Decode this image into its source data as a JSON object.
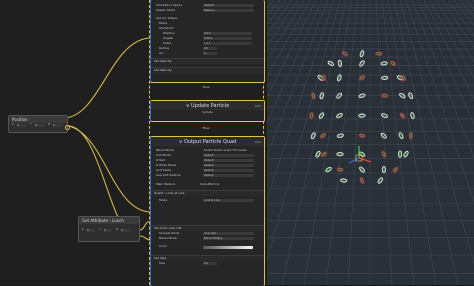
{
  "graph": {
    "position_node": {
      "title": "Position",
      "fields": [
        "X",
        "Y",
        "Z"
      ],
      "values": [
        "0",
        "0",
        "0"
      ]
    },
    "getattr_node": {
      "title": "Get Attribute : Lunch",
      "fields": [
        "X",
        "Y",
        "Z"
      ],
      "values": [
        "0",
        "0",
        "0"
      ]
    },
    "init_context": {
      "rows": [
        {
          "label": "Simulation Space",
          "value": "Default"
        },
        {
          "label": "Spawn Mode",
          "value": "Balance"
        },
        {
          "label": "Set Arc Shape",
          "value": ""
        },
        {
          "label": "Mode",
          "value": ""
        },
        {
          "label": "Transform",
          "value": ""
        },
        {
          "label": "Position",
          "value": "0   0   0"
        },
        {
          "label": "Angles",
          "value": "0   90   0"
        },
        {
          "label": "Scale",
          "value": "1   1   1"
        },
        {
          "label": "Radius",
          "value": "0.5"
        },
        {
          "label": "Arc",
          "value": "0"
        }
      ],
      "sections": [
        "Set Velocity",
        "Set Velocity"
      ]
    },
    "update_context": {
      "title": "Update Particle",
      "tag": "GPU",
      "flow_label": "Flow",
      "row": "Update"
    },
    "output_context": {
      "title": "Output Particle Quad",
      "tag": "GPU",
      "rows": [
        {
          "label": "Blend Mode",
          "value": "Enable Shader Graph VFX Assets"
        },
        {
          "label": "Cull Mode",
          "value": "Default"
        },
        {
          "label": "Z Test",
          "value": "Default"
        },
        {
          "label": "Z Write Mode",
          "value": "Default"
        },
        {
          "label": "Sort Mode",
          "value": "Default"
        },
        {
          "label": "Use Soft Particle",
          "value": "Default"
        }
      ],
      "sections": [
        {
          "title": "Main Texture",
          "value": "DefaultParticle"
        },
        {
          "title": "Orient : Look at Line",
          "value": ""
        },
        {
          "title": "Mode",
          "value": "Look at Line"
        },
        {
          "title": "Set Color over Life",
          "value": ""
        },
        {
          "title": "Set Size",
          "value": "0.1"
        }
      ],
      "color_rows": [
        {
          "label": "Sample Mode",
          "value": "Over Life"
        },
        {
          "label": "Blend Mode",
          "value": "Blend Multiply"
        },
        {
          "label": "Color",
          "value": ""
        }
      ],
      "size_label": "Size"
    }
  }
}
